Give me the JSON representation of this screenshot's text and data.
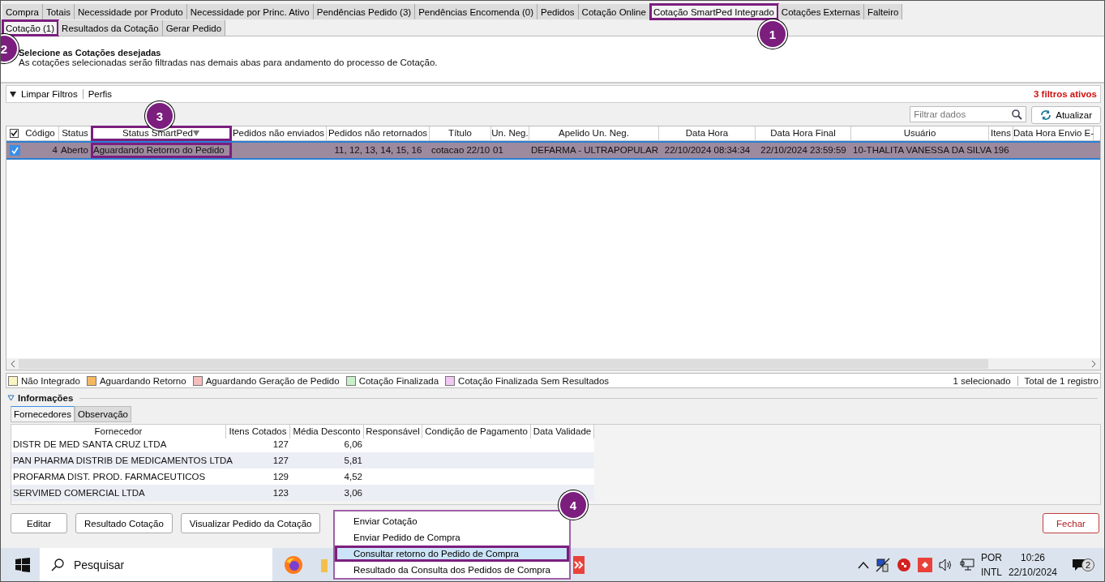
{
  "main_tabs": [
    {
      "label": "Compra",
      "selected": false,
      "annotated": false
    },
    {
      "label": "Totais",
      "selected": false,
      "annotated": false
    },
    {
      "label": "Necessidade por Produto",
      "selected": false,
      "annotated": false
    },
    {
      "label": "Necessidade por Princ. Ativo",
      "selected": false,
      "annotated": false
    },
    {
      "label": "Pendências Pedido (3)",
      "selected": false,
      "annotated": false
    },
    {
      "label": "Pendências Encomenda (0)",
      "selected": false,
      "annotated": false
    },
    {
      "label": "Pedidos",
      "selected": false,
      "annotated": false
    },
    {
      "label": "Cotação Online",
      "selected": false,
      "annotated": false
    },
    {
      "label": "Cotação SmartPed Integrado",
      "selected": true,
      "annotated": true
    },
    {
      "label": "Cotações Externas",
      "selected": false,
      "annotated": false
    },
    {
      "label": "Falteiro",
      "selected": false,
      "annotated": false
    }
  ],
  "sub_tabs": [
    {
      "label": "Cotação (1)",
      "selected": true,
      "annotated": true
    },
    {
      "label": "Resultados da Cotação",
      "selected": false,
      "annotated": false
    },
    {
      "label": "Gerar Pedido",
      "selected": false,
      "annotated": false
    }
  ],
  "intro": {
    "title": "Selecione as Cotações desejadas",
    "text": "As cotações selecionadas serão filtradas nas demais abas para andamento do processo de Cotação."
  },
  "filter_bar": {
    "clear": "Limpar Filtros",
    "profiles": "Perfis",
    "active": "3 filtros ativos"
  },
  "search": {
    "placeholder": "Filtrar dados"
  },
  "refresh_button": "Atualizar",
  "table": {
    "all_checked": true,
    "columns": [
      {
        "label": "Código",
        "annotated": false
      },
      {
        "label": "Status",
        "annotated": false
      },
      {
        "label": "Status SmartPed",
        "annotated": true,
        "sorted": true
      },
      {
        "label": "Pedidos não enviados",
        "annotated": false
      },
      {
        "label": "Pedidos não retornados",
        "annotated": false
      },
      {
        "label": "Título",
        "annotated": false
      },
      {
        "label": "Un. Neg.",
        "annotated": false
      },
      {
        "label": "Apelido Un. Neg.",
        "annotated": false
      },
      {
        "label": "Data Hora",
        "annotated": false
      },
      {
        "label": "Data Hora Final",
        "annotated": false
      },
      {
        "label": "Usuário",
        "annotated": false
      },
      {
        "label": "Itens",
        "annotated": false
      },
      {
        "label": "Data Hora Envio E-",
        "annotated": false
      }
    ],
    "rows": [
      {
        "selected": true,
        "checked": true,
        "color": "#9e8a9e",
        "cells": [
          "4",
          "Aberto",
          "Aguardando Retorno do Pedido",
          null,
          "11, 12, 13, 14, 15, 16",
          "cotacao 22/10",
          "01",
          "DEFARMA - ULTRAPOPULAR",
          "22/10/2024 08:34:34",
          "22/10/2024 23:59:59",
          "10-THALITA VANESSA DA SILVA",
          "196",
          null
        ]
      }
    ]
  },
  "legend": [
    {
      "label": "Não Integrado",
      "color": "#fbf5c4"
    },
    {
      "label": "Aguardando Retorno",
      "color": "#f5b860"
    },
    {
      "label": "Aguardando Geração de Pedido",
      "color": "#f7bcbc"
    },
    {
      "label": "Cotação Finalizada",
      "color": "#c9f0c9"
    },
    {
      "label": "Cotação Finalizada Sem Resultados",
      "color": "#f3c6f3"
    }
  ],
  "summary": {
    "selected": "1 selecionado",
    "total": "Total de 1 registro"
  },
  "info": {
    "title": "Informações",
    "expanded": true,
    "tabs": [
      {
        "label": "Fornecedores",
        "selected": true
      },
      {
        "label": "Observação",
        "selected": false
      }
    ],
    "columns": [
      "Fornecedor",
      "Itens Cotados",
      "Média Desconto",
      "Responsável",
      "Condição de Pagamento",
      "Data Validade"
    ],
    "rows": [
      [
        "DISTR DE MED SANTA CRUZ LTDA",
        "127",
        "6,06"
      ],
      [
        "PAN PHARMA DISTRIB DE MEDICAMENTOS LTDA",
        "127",
        "5,81"
      ],
      [
        "PROFARMA DIST. PROD. FARMACEUTICOS",
        "129",
        "4,52"
      ],
      [
        "SERVIMED COMERCIAL LTDA",
        "123",
        "3,06"
      ]
    ]
  },
  "buttons": [
    {
      "label": "Editar",
      "kind": "normal"
    },
    {
      "label": "Resultado Cotação",
      "kind": "normal"
    },
    {
      "label": "Visualizar Pedido da Cotação",
      "kind": "normal"
    },
    {
      "label": "Fechar",
      "kind": "danger"
    }
  ],
  "context_menu": [
    {
      "label": "Enviar Cotação",
      "selected": false,
      "annotated": false
    },
    {
      "label": "Enviar Pedido de Compra",
      "selected": false,
      "annotated": false
    },
    {
      "label": "Consultar retorno do Pedido de Compra",
      "selected": true,
      "annotated": true
    },
    {
      "label": "Resultado da Consulta dos Pedidos de Compra",
      "selected": false,
      "annotated": false
    }
  ],
  "annotations": [
    "1",
    "2",
    "3",
    "4"
  ],
  "taskbar": {
    "search": "Pesquisar",
    "language": "POR",
    "layout": "INTL",
    "time": "10:26",
    "date": "22/10/2024",
    "notifications": "2"
  }
}
